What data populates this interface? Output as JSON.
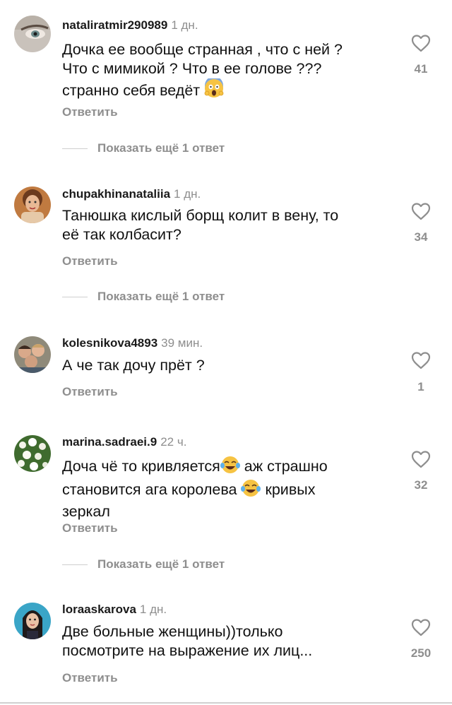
{
  "comments": [
    {
      "username": "nataliratmir290989",
      "time": "1 дн.",
      "text_lines": [
        "Дочка ее вообще странная , что с ней ?",
        "Что с мимикой ? Что в ее голове ???",
        "странно себя ведёт"
      ],
      "emoji": "screaming-face-emoji",
      "likes": "41",
      "reply_label": "Ответить",
      "more_label": "Показать ещё 1 ответ"
    },
    {
      "username": "chupakhinanataliia",
      "time": "1 дн.",
      "text_lines": [
        "Танюшка кислый борщ колит в вену, то",
        "её  так  колбасит?"
      ],
      "likes": "34",
      "reply_label": "Ответить",
      "more_label": "Показать ещё 1 ответ"
    },
    {
      "username": "kolesnikova4893",
      "time": "39 мин.",
      "text_lines": [
        "А че так дочу прёт ?"
      ],
      "likes": "1",
      "reply_label": "Ответить"
    },
    {
      "username": "marina.sadraei.9",
      "time": "22 ч.",
      "text_line1_a": "Доча чё то кривляется",
      "text_line1_b": " аж страшно",
      "text_line2_a": "становится ага королева ",
      "text_line2_b": " кривых",
      "text_line3": "зеркал",
      "emoji": "tears-of-joy-emoji",
      "likes": "32",
      "reply_label": "Ответить",
      "more_label": "Показать ещё 1 ответ"
    },
    {
      "username": "loraaskarova",
      "time": "1 дн.",
      "text_lines": [
        "Две больные женщины))только",
        "посмотрите на выражение их лиц..."
      ],
      "likes": "250",
      "reply_label": "Ответить"
    }
  ],
  "icons": {
    "like": "heart-outline-icon"
  },
  "colors": {
    "muted": "#8e8e8e",
    "text": "#111111",
    "background": "#ffffff"
  }
}
